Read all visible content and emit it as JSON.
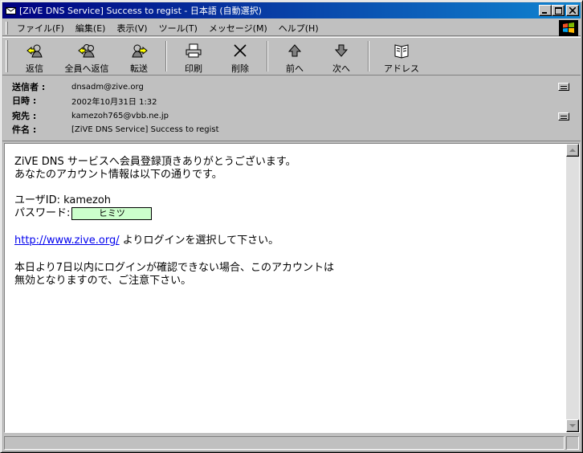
{
  "window": {
    "title": "[ZiVE DNS Service] Success to regist - 日本語 (自動選択)",
    "minimize_glyph": "_",
    "maximize_glyph": "□",
    "close_glyph": "×"
  },
  "menu": [
    {
      "label": "ファイル(F)"
    },
    {
      "label": "編集(E)"
    },
    {
      "label": "表示(V)"
    },
    {
      "label": "ツール(T)"
    },
    {
      "label": "メッセージ(M)"
    },
    {
      "label": "ヘルプ(H)"
    }
  ],
  "toolbar": {
    "reply": "返信",
    "reply_all": "全員へ返信",
    "forward": "転送",
    "print": "印刷",
    "delete": "削除",
    "prev": "前へ",
    "next": "次へ",
    "addresses": "アドレス"
  },
  "headers": {
    "from_label": "送信者 :",
    "from_value": "dnsadm@zive.org",
    "date_label": "日時 :",
    "date_value": "2002年10月31日 1:32",
    "to_label": "宛先 :",
    "to_value": "kamezoh765@vbb.ne.jp",
    "subject_label": "件名 :",
    "subject_value": "[ZiVE DNS Service] Success to regist"
  },
  "body": {
    "line1": "ZiVE DNS サービスへ会員登録頂きありがとうございます。",
    "line2": "あなたのアカウント情報は以下の通りです。",
    "userid_line": "ユーザID: kamezoh",
    "password_label": "パスワード:",
    "password_value": "ヒミツ",
    "link_text": "http://www.zive.org/",
    "link_suffix": " よりログインを選択して下さい。",
    "line5": "本日より7日以内にログインが確認できない場合、このアカウントは",
    "line6": "無効となりますので、ご注意下さい。"
  },
  "colors": {
    "titlebar_start": "#000080",
    "titlebar_end": "#1084d0",
    "password_bg": "#ccffcc",
    "link": "#0000ee"
  }
}
